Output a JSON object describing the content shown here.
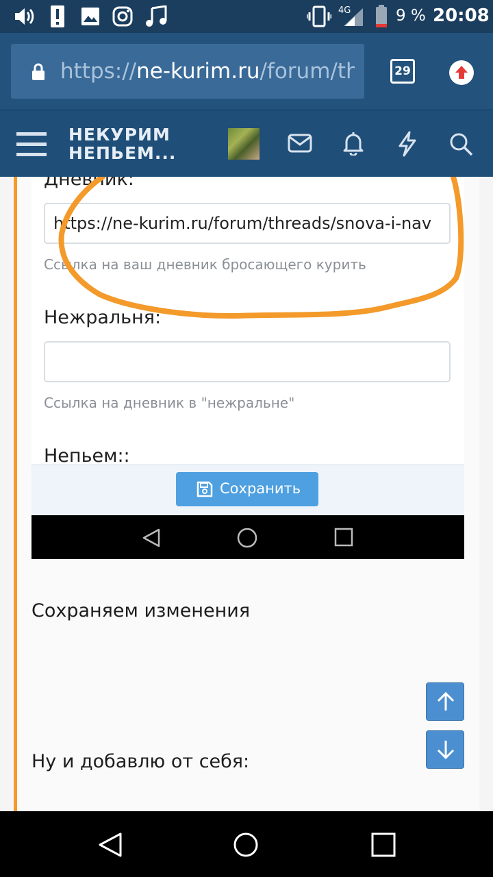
{
  "status_bar": {
    "signal": "4G",
    "battery": "9 %",
    "time": "20:08"
  },
  "browser": {
    "url_prefix": "https://",
    "url_host": "ne-kurim.ru",
    "url_path": "/forum/threads/",
    "tab_count": "29"
  },
  "forum": {
    "logo_line1": "НЕКУРИМ",
    "logo_line2": "НЕПЬЕМ..."
  },
  "screenshot": {
    "diary_label": "Дневник:",
    "diary_value": "https://ne-kurim.ru/forum/threads/snova-i-nav",
    "diary_hint": "Ссылка на ваш дневник бросающего курить",
    "nezhral_label": "Нежральня:",
    "nezhral_value": "",
    "nezhral_hint": "Ссылка на дневник в \"нежральне\"",
    "nepiem_label": "Непьем::",
    "save_label": "Сохранить"
  },
  "post": {
    "text1": "Сохраняем изменения",
    "text2": "Ну и добавлю от себя:"
  },
  "colors": {
    "accent_orange": "#f39a2b",
    "header_blue": "#1f4e79",
    "save_button": "#4ea0e0"
  }
}
